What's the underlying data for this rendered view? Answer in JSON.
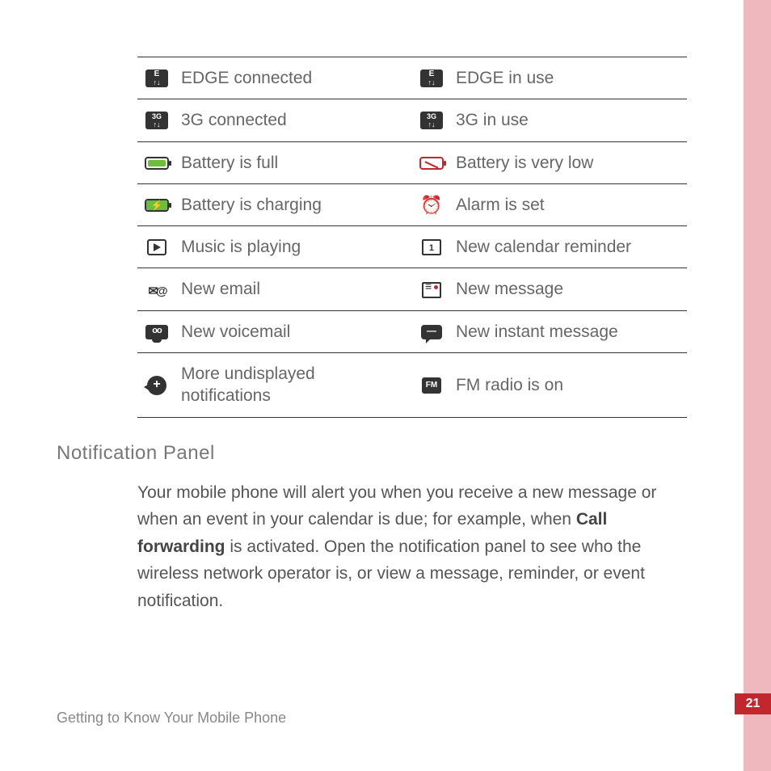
{
  "icons": {
    "r0c0": "EDGE connected",
    "r0c1": "EDGE in use",
    "r1c0": "3G connected",
    "r1c1": "3G in use",
    "r2c0": "Battery is full",
    "r2c1": "Battery is very low",
    "r3c0": "Battery is charging",
    "r3c1": "Alarm is set",
    "r4c0": "Music is playing",
    "r4c1": "New calendar reminder",
    "r5c0": "New email",
    "r5c1": "New message",
    "r6c0": "New voicemail",
    "r6c1": "New instant message",
    "r7c0": "More undisplayed notifications",
    "r7c1": "FM radio is on"
  },
  "heading": "Notification Panel",
  "paragraph_pre": "Your mobile phone will alert you when you receive a new message or when an event in your calendar is due; for example, when ",
  "paragraph_bold": "Call forwarding",
  "paragraph_post": " is activated. Open the notification panel to see who the wireless network operator is, or view a message, reminder, or event notification.",
  "footer": "Getting to Know Your Mobile Phone",
  "page_number": "21"
}
